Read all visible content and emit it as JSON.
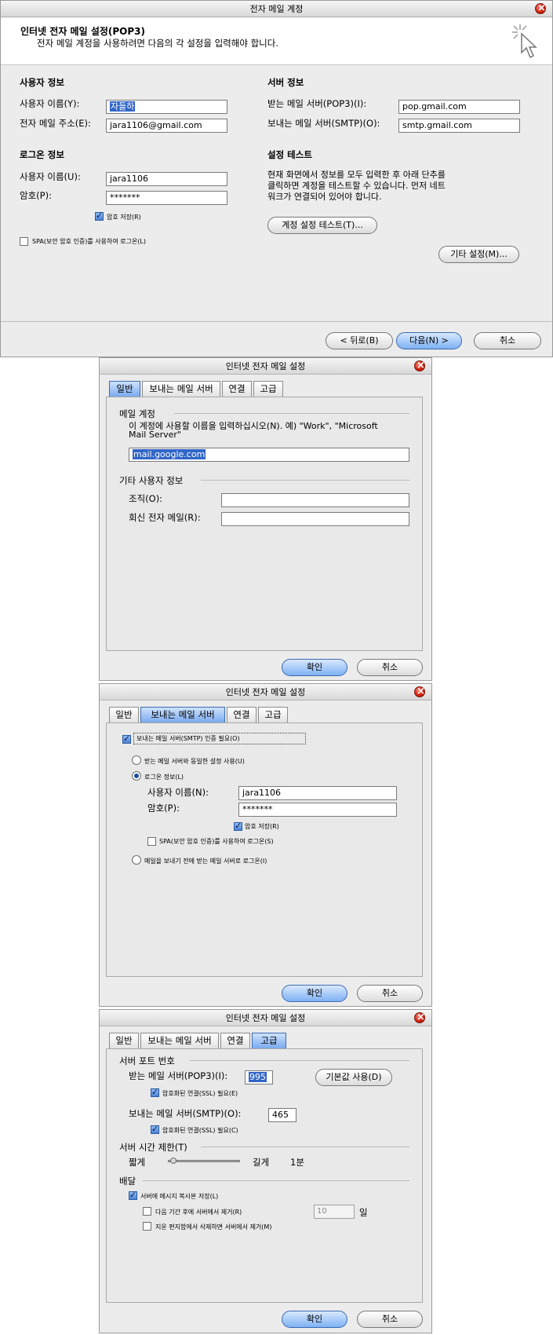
{
  "w1": {
    "title": "전자 메일 계정",
    "header_title": "인터넷 전자 메일 설정(POP3)",
    "header_sub": "전자 메일 계정을 사용하려면 다음의 각 설정을 입력해야 합니다.",
    "user_info": "사용자 정보",
    "name_label": "사용자 이름(Y):",
    "name_value": "자들하",
    "email_label": "전자 메일 주소(E):",
    "email_value": "jara1106@gmail.com",
    "login_info": "로그온 정보",
    "login_user_label": "사용자 이름(U):",
    "login_user_value": "jara1106",
    "password_label": "암호(P):",
    "password_value": "*******",
    "save_password": "암호 저장(R)",
    "spa_label": "SPA(보안 암호 인증)를 사용하여 로그온(L)",
    "server_info": "서버 정보",
    "incoming_label": "받는 메일 서버(POP3)(I):",
    "incoming_value": "pop.gmail.com",
    "outgoing_label": "보내는 메일 서버(SMTP)(O):",
    "outgoing_value": "smtp.gmail.com",
    "test_title": "설정 테스트",
    "test_desc_1": "현재 화면에서 정보를 모두 입력한 후 아래 단추를",
    "test_desc_2": "클릭하면 계정을 테스트할 수 있습니다. 먼저 네트",
    "test_desc_3": "워크가 연결되어 있어야 합니다.",
    "test_button": "계정 설정 테스트(T)...",
    "more_settings_button": "기타 설정(M)...",
    "back_button": "< 뒤로(B)",
    "next_button": "다음(N) >",
    "cancel_button": "취소"
  },
  "w2": {
    "title": "인터넷 전자 메일 설정",
    "tabs": [
      "일반",
      "보내는 메일 서버",
      "연결",
      "고급"
    ],
    "mail_account": "메일 계정",
    "desc_1": "이 계정에 사용할 이름을 입력하십시오(N). 예) \"Work\", \"Microsoft",
    "desc_2": "Mail Server\"",
    "account_name": "mail.google.com",
    "other_info": "기타 사용자 정보",
    "org_label": "조직(O):",
    "reply_label": "회신 전자 메일(R):",
    "ok": "확인",
    "cancel": "취소"
  },
  "w3": {
    "title": "인터넷 전자 메일 설정",
    "tabs": [
      "일반",
      "보내는 메일 서버",
      "연결",
      "고급"
    ],
    "smtp_auth": "보내는 메일 서버(SMTP) 인증 필요(O)",
    "same_settings": "받는 메일 서버와 동일한 설정 사용(U)",
    "login_info": "로그온 정보(L)",
    "user_label": "사용자 이름(N):",
    "user_value": "jara1106",
    "password_label": "암호(P):",
    "password_value": "*******",
    "save_password": "암호 저장(R)",
    "spa": "SPA(보안 암호 인증)를 사용하여 로그온(S)",
    "login_before": "메일을 보내기 전에 받는 메일 서버로 로그온(I)",
    "ok": "확인",
    "cancel": "취소"
  },
  "w4": {
    "title": "인터넷 전자 메일 설정",
    "tabs": [
      "일반",
      "보내는 메일 서버",
      "연결",
      "고급"
    ],
    "port_title": "서버 포트 번호",
    "incoming_label": "받는 메일 서버(POP3)(I):",
    "incoming_port": "995",
    "default_button": "기본값 사용(D)",
    "ssl_in": "암호화된 연결(SSL) 필요(E)",
    "outgoing_label": "보내는 메일 서버(SMTP)(O):",
    "outgoing_port": "465",
    "ssl_out": "암호화된 연결(SSL) 필요(C)",
    "timeout_title": "서버 시간 제한(T)",
    "short": "짧게",
    "long": "길게",
    "timeout_value": "1분",
    "delivery_title": "배달",
    "keep_copy": "서버에 메시지 복사본 저장(L)",
    "remove_after": "다음 기간 후에 서버에서 제거(R)",
    "days_value": "10",
    "days_unit": "일",
    "remove_deleted": "지운 편지함에서 삭제하면 서버에서 제거(M)",
    "ok": "확인",
    "cancel": "취소"
  }
}
